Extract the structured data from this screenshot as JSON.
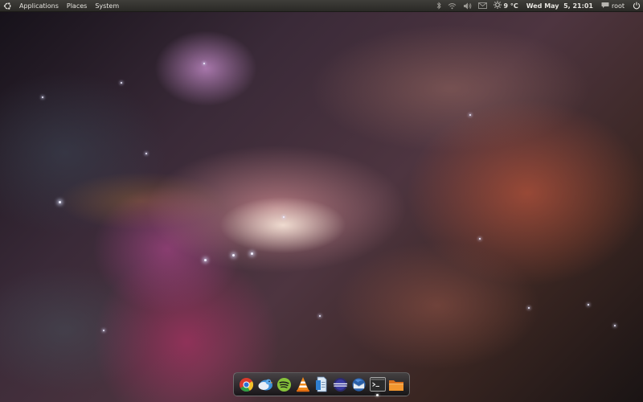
{
  "top_panel": {
    "menus": [
      {
        "label": "Applications"
      },
      {
        "label": "Places"
      },
      {
        "label": "System"
      }
    ],
    "tray": {
      "weather": {
        "temperature": "9 °C",
        "icon": "sun-icon"
      },
      "clock": "Wed May  5, 21:01",
      "user": {
        "name": "root",
        "icon": "chat-bubble-icon"
      },
      "indicators": [
        "bluetooth-icon",
        "wifi-icon",
        "volume-icon",
        "mail-icon",
        "power-icon"
      ]
    }
  },
  "dock": {
    "items": [
      {
        "name": "chrome",
        "icon": "chrome-icon"
      },
      {
        "name": "pidgin",
        "icon": "pidgin-icon"
      },
      {
        "name": "spotify",
        "icon": "spotify-icon"
      },
      {
        "name": "vlc",
        "icon": "vlc-icon"
      },
      {
        "name": "document",
        "icon": "document-icon"
      },
      {
        "name": "eclipse",
        "icon": "eclipse-icon"
      },
      {
        "name": "thunderbird",
        "icon": "thunderbird-icon"
      },
      {
        "name": "terminal",
        "icon": "terminal-icon",
        "running": true
      },
      {
        "name": "file-manager",
        "icon": "folder-icon"
      }
    ]
  },
  "colors": {
    "panel": "#2f2e2b",
    "panel_text": "#e6e4df",
    "dock": "#2a2a2c"
  }
}
